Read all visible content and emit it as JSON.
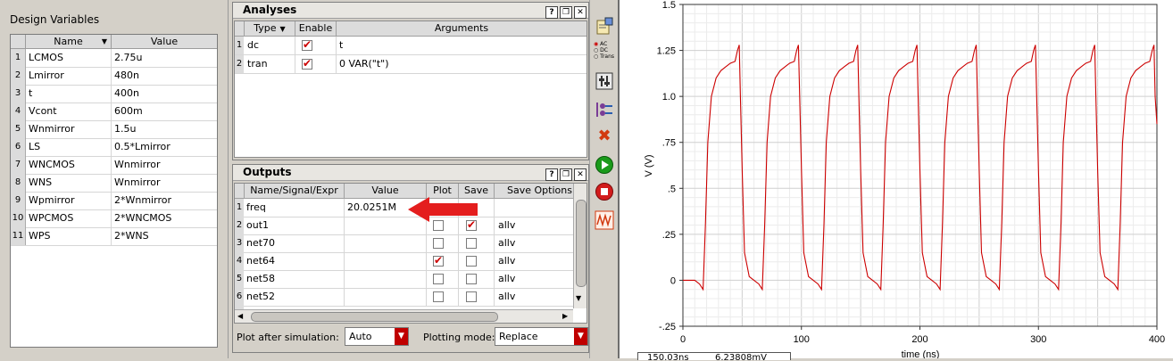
{
  "design_variables": {
    "title": "Design Variables",
    "columns": [
      "Name",
      "Value"
    ],
    "rows": [
      {
        "idx": "1",
        "name": "LCMOS",
        "value": "2.75u"
      },
      {
        "idx": "2",
        "name": "Lmirror",
        "value": "480n"
      },
      {
        "idx": "3",
        "name": "t",
        "value": "400n"
      },
      {
        "idx": "4",
        "name": "Vcont",
        "value": "600m"
      },
      {
        "idx": "5",
        "name": "Wnmirror",
        "value": "1.5u"
      },
      {
        "idx": "6",
        "name": "LS",
        "value": "0.5*Lmirror"
      },
      {
        "idx": "7",
        "name": "WNCMOS",
        "value": "Wnmirror"
      },
      {
        "idx": "8",
        "name": "WNS",
        "value": "Wnmirror"
      },
      {
        "idx": "9",
        "name": "Wpmirror",
        "value": "2*Wnmirror"
      },
      {
        "idx": "10",
        "name": "WPCMOS",
        "value": "2*WNCMOS"
      },
      {
        "idx": "11",
        "name": "WPS",
        "value": "2*WNS"
      }
    ]
  },
  "analyses": {
    "title": "Analyses",
    "columns": [
      "Type",
      "Enable",
      "Arguments"
    ],
    "rows": [
      {
        "idx": "1",
        "type": "dc",
        "enabled": true,
        "args": "t"
      },
      {
        "idx": "2",
        "type": "tran",
        "enabled": true,
        "args": "0 VAR(\"t\")"
      }
    ]
  },
  "outputs": {
    "title": "Outputs",
    "columns": [
      "Name/Signal/Expr",
      "Value",
      "Plot",
      "Save",
      "Save Options"
    ],
    "rows": [
      {
        "idx": "1",
        "name": "freq",
        "value": "20.0251M",
        "plot": null,
        "save": null,
        "opt": ""
      },
      {
        "idx": "2",
        "name": "out1",
        "value": "",
        "plot": false,
        "save": true,
        "opt": "allv"
      },
      {
        "idx": "3",
        "name": "net70",
        "value": "",
        "plot": false,
        "save": false,
        "opt": "allv"
      },
      {
        "idx": "4",
        "name": "net64",
        "value": "",
        "plot": true,
        "save": false,
        "opt": "allv"
      },
      {
        "idx": "5",
        "name": "net58",
        "value": "",
        "plot": false,
        "save": false,
        "opt": "allv"
      },
      {
        "idx": "6",
        "name": "net52",
        "value": "",
        "plot": false,
        "save": false,
        "opt": "allv"
      }
    ],
    "plot_after_label": "Plot after simulation:",
    "plot_after_value": "Auto",
    "plotting_mode_label": "Plotting mode:",
    "plotting_mode_value": "Replace"
  },
  "toolbar": {
    "icons": [
      "setup-icon",
      "ac-dc-trans-icon",
      "variables-icon",
      "outputs-icon",
      "delete-icon",
      "run-icon",
      "stop-icon",
      "plot-icon"
    ],
    "ac_dc_trans_labels": [
      "AC",
      "DC",
      "Trans"
    ]
  },
  "colors": {
    "accent_red": "#cc0000",
    "trace": "#cc0000",
    "run_green": "#1a9a1a"
  },
  "chart_data": {
    "type": "line",
    "xlabel": "time (ns)",
    "ylabel": "V (V)",
    "xlim": [
      0,
      400
    ],
    "ylim": [
      -0.25,
      1.5
    ],
    "xticks": [
      "0",
      "100",
      "200",
      "300",
      "400"
    ],
    "yticks": [
      "-.25",
      "0",
      ".25",
      ".5",
      ".75",
      "1.0",
      "1.25",
      "1.5"
    ],
    "grid": true,
    "period_ns": 49.94,
    "first_rise_ns": 18,
    "series": [
      {
        "x": [
          0,
          10,
          14,
          17,
          19,
          21,
          24,
          28,
          32,
          36,
          40,
          44,
          46,
          47.5,
          48.5,
          50,
          52,
          56,
          60,
          64,
          67,
          69,
          71,
          74,
          78,
          82,
          86,
          90,
          94,
          96,
          97.5,
          98.5,
          100,
          102,
          106,
          110,
          114,
          117,
          119,
          121,
          124,
          128,
          132,
          136,
          140,
          144,
          146,
          147.5,
          148.5,
          150,
          152,
          156,
          160,
          164,
          167,
          169,
          171,
          174,
          178,
          182,
          186,
          190,
          194,
          196,
          197.5,
          198.5,
          200,
          202,
          206,
          210,
          214,
          217,
          219,
          221,
          224,
          228,
          232,
          236,
          240,
          244,
          246,
          247.5,
          248.5,
          250,
          252,
          256,
          260,
          264,
          267,
          269,
          271,
          274,
          278,
          282,
          286,
          290,
          294,
          296,
          297.5,
          298.5,
          300,
          302,
          306,
          310,
          314,
          317,
          319,
          321,
          324,
          328,
          332,
          336,
          340,
          344,
          346,
          347.5,
          348.5,
          350,
          352,
          356,
          360,
          364,
          367,
          369,
          371,
          374,
          378,
          382,
          386,
          390,
          394,
          396,
          397.5,
          398.5,
          400
        ],
        "y": [
          0.0,
          0.0,
          -0.02,
          -0.05,
          0.3,
          0.75,
          1.0,
          1.1,
          1.14,
          1.16,
          1.18,
          1.19,
          1.25,
          1.28,
          1.0,
          0.6,
          0.15,
          0.02,
          0.0,
          -0.02,
          -0.05,
          0.3,
          0.75,
          1.0,
          1.1,
          1.14,
          1.16,
          1.18,
          1.19,
          1.25,
          1.28,
          1.0,
          0.6,
          0.15,
          0.02,
          0.0,
          -0.02,
          -0.05,
          0.3,
          0.75,
          1.0,
          1.1,
          1.14,
          1.16,
          1.18,
          1.19,
          1.25,
          1.28,
          1.0,
          0.6,
          0.15,
          0.02,
          0.0,
          -0.02,
          -0.05,
          0.3,
          0.75,
          1.0,
          1.1,
          1.14,
          1.16,
          1.18,
          1.19,
          1.25,
          1.28,
          1.0,
          0.6,
          0.15,
          0.02,
          0.0,
          -0.02,
          -0.05,
          0.3,
          0.75,
          1.0,
          1.1,
          1.14,
          1.16,
          1.18,
          1.19,
          1.25,
          1.28,
          1.0,
          0.6,
          0.15,
          0.02,
          0.0,
          -0.02,
          -0.05,
          0.3,
          0.75,
          1.0,
          1.1,
          1.14,
          1.16,
          1.18,
          1.19,
          1.25,
          1.28,
          1.0,
          0.6,
          0.15,
          0.02,
          0.0,
          -0.02,
          -0.05,
          0.3,
          0.75,
          1.0,
          1.1,
          1.14,
          1.16,
          1.18,
          1.19,
          1.25,
          1.28,
          1.0,
          0.6,
          0.15,
          0.02,
          0.0,
          -0.02,
          -0.05,
          0.3,
          0.75,
          1.0,
          1.1,
          1.14,
          1.16,
          1.18,
          1.19,
          1.25,
          1.28,
          1.0,
          0.85
        ]
      }
    ]
  },
  "status": {
    "left": "150.03ns",
    "right": "6.23808mV"
  }
}
